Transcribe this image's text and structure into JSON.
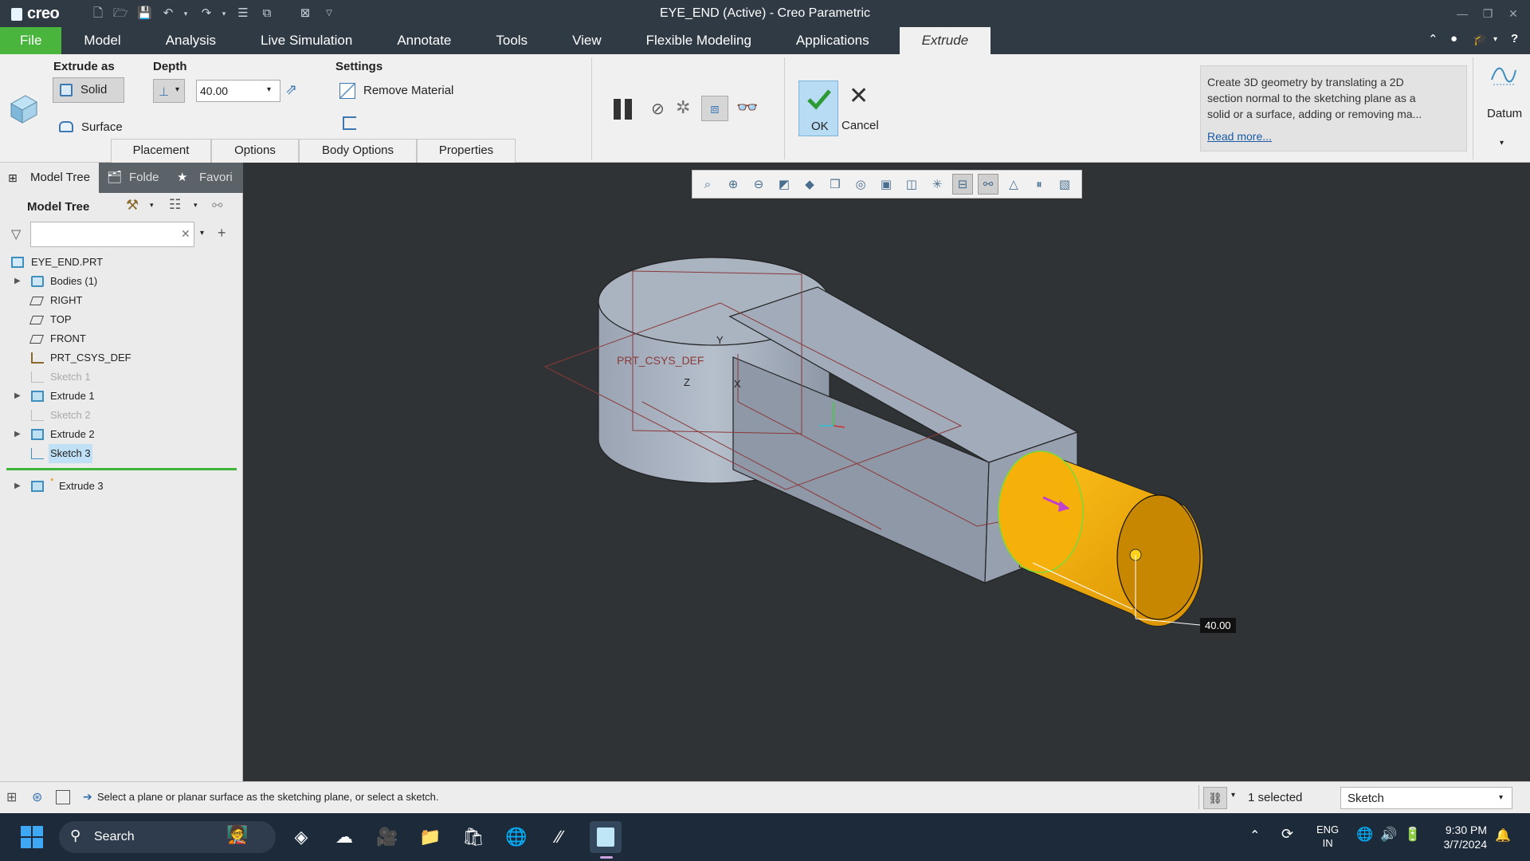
{
  "app": {
    "logo": "creo",
    "window_title": "EYE_END (Active) - Creo Parametric"
  },
  "ribbon_tabs": [
    {
      "label": "File"
    },
    {
      "label": "Model"
    },
    {
      "label": "Analysis"
    },
    {
      "label": "Live Simulation"
    },
    {
      "label": "Annotate"
    },
    {
      "label": "Tools"
    },
    {
      "label": "View"
    },
    {
      "label": "Flexible Modeling"
    },
    {
      "label": "Applications"
    },
    {
      "label": "Extrude"
    }
  ],
  "extrude": {
    "extrude_as_label": "Extrude as",
    "solid_label": "Solid",
    "surface_label": "Surface",
    "depth_label": "Depth",
    "depth_value": "40.00",
    "settings_label": "Settings",
    "remove_material_label": "Remove Material",
    "ok_label": "OK",
    "cancel_label": "Cancel",
    "help_text": "Create 3D geometry by translating a 2D section normal to the sketching plane as a solid or a surface, adding or removing ma...",
    "read_more": "Read more...",
    "datum_label": "Datum",
    "subtabs": [
      {
        "label": "Placement"
      },
      {
        "label": "Options"
      },
      {
        "label": "Body Options"
      },
      {
        "label": "Properties"
      }
    ]
  },
  "left_panel": {
    "tabs": [
      {
        "label": "Model Tree"
      },
      {
        "label": "Folde"
      },
      {
        "label": "Favori"
      }
    ],
    "tree_title": "Model Tree",
    "search_value": "",
    "items": [
      {
        "label": "EYE_END.PRT"
      },
      {
        "label": "Bodies (1)"
      },
      {
        "label": "RIGHT"
      },
      {
        "label": "TOP"
      },
      {
        "label": "FRONT"
      },
      {
        "label": "PRT_CSYS_DEF"
      },
      {
        "label": "Sketch 1"
      },
      {
        "label": "Extrude 1"
      },
      {
        "label": "Sketch 2"
      },
      {
        "label": "Extrude 2"
      },
      {
        "label": "Sketch 3"
      },
      {
        "label": "Extrude 3"
      }
    ]
  },
  "viewport": {
    "csys_label": "PRT_CSYS_DEF",
    "axis_y": "Y",
    "axis_z": "Z",
    "axis_x": "X",
    "dimension_value": "40.00",
    "colors": {
      "background": "#2f3336",
      "body": "#a4adbb",
      "extrude_preview": "#f2a900"
    }
  },
  "status_bar": {
    "message": "Select a plane or planar surface as the sketching plane, or select a sketch.",
    "selected_count": "1 selected",
    "filter_value": "Sketch"
  },
  "taskbar": {
    "search_label": "Search",
    "lang_line1": "ENG",
    "lang_line2": "IN",
    "time": "9:30 PM",
    "date": "3/7/2024"
  }
}
